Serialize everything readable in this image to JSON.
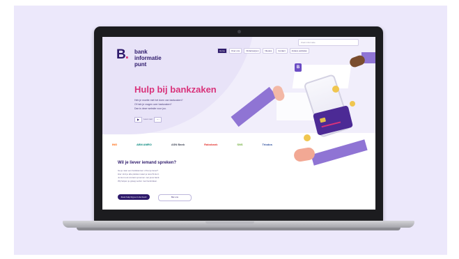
{
  "site": {
    "logo_mark": "B",
    "logo_dot": ".",
    "logo_lines": [
      "bank",
      "informatie",
      "punt"
    ],
    "search_placeholder": "Zoek informatie",
    "nav": [
      {
        "label": "Home",
        "active": true
      },
      {
        "label": "Over ons",
        "active": false
      },
      {
        "label": "Onderwerpen",
        "active": false
      },
      {
        "label": "Nieuws",
        "active": false
      },
      {
        "label": "Contact",
        "active": false
      },
      {
        "label": "Andere websites",
        "active": false
      }
    ],
    "hero": {
      "title": "Hulp bij bankzaken",
      "lines": [
        "Heb je moeite met het doen van bankzaken?",
        "Of heb je vragen over bankzaken?",
        "Dan is deze website voor jou."
      ],
      "control_label": "Lees voor"
    },
    "banks": [
      {
        "name": "ING",
        "color": "#ff6200"
      },
      {
        "name": "ABN AMRO",
        "color": "#00857a"
      },
      {
        "name": "ASN Bank",
        "color": "#444a5a"
      },
      {
        "name": "Rabobank",
        "color": "#e3342f"
      },
      {
        "name": "SNS",
        "color": "#6fae3b"
      },
      {
        "name": "Triodos",
        "color": "#2e4f9e"
      }
    ],
    "contact": {
      "title": "Wil je liever iemand spreken?",
      "lines": [
        "Ga je naar een bankkantoor of bel je liever?",
        "Hier vind je alle plekken waar je terecht kunt.",
        "Je kunt ook contact opnemen met jouw bank.",
        "Wij helpen je graag verder met bankzaken."
      ],
      "primary_label": "Zoek hulp bij jou in de buurt",
      "secondary_label": "Bel ons"
    }
  },
  "colors": {
    "accent": "#d9327a",
    "brand": "#2e1a6b",
    "background": "#ece8fb"
  },
  "icons": [
    "camera-icon",
    "card-icon",
    "coin-icon"
  ]
}
